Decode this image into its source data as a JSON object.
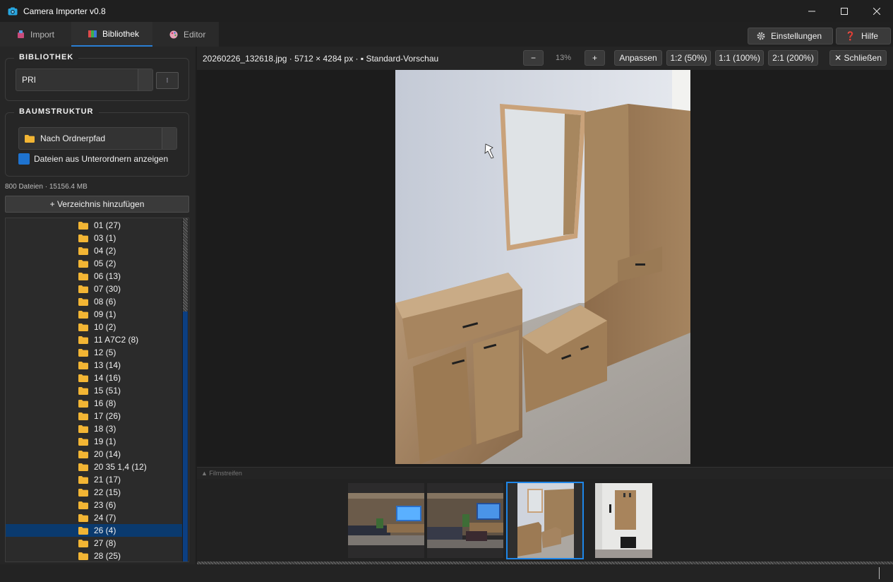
{
  "window": {
    "title": "Camera Importer v0.8"
  },
  "tabs": [
    {
      "label": "Import",
      "icon": "import-icon"
    },
    {
      "label": "Bibliothek",
      "icon": "library-icon"
    },
    {
      "label": "Editor",
      "icon": "palette-icon"
    }
  ],
  "toolbar": {
    "settings_label": "Einstellungen",
    "help_label": "Hilfe",
    "help_glyph": "❓"
  },
  "library": {
    "section_label": "BIBLIOTHEK",
    "selected": "PRI",
    "menu_glyph": "⁝"
  },
  "tree_structure": {
    "section_label": "BAUMSTRUKTUR",
    "selected": "Nach Ordnerpfad",
    "show_subfolders_label": "Dateien aus Unterordnern anzeigen",
    "show_subfolders_checked": true
  },
  "file_info": "800 Dateien  ·  15156.4 MB",
  "add_directory_label": "+ Verzeichnis hinzufügen",
  "folders": [
    "01  (27)",
    "03  (1)",
    "04  (2)",
    "05  (2)",
    "06  (13)",
    "07  (30)",
    "08  (6)",
    "09  (1)",
    "10  (2)",
    "11 A7C2  (8)",
    "12  (5)",
    "13  (14)",
    "14  (16)",
    "15  (51)",
    "16  (8)",
    "17  (26)",
    "18  (3)",
    "19  (1)",
    "20  (14)",
    "20 35 1,4  (12)",
    "21  (17)",
    "22  (15)",
    "23  (6)",
    "24  (7)",
    "26  (4)",
    "27  (8)",
    "28  (25)"
  ],
  "selected_folder": "26  (4)",
  "viewer": {
    "info": "20260226_132618.jpg  ·  5712 × 4284 px  ·  ▪ Standard-Vorschau",
    "zoom_out": "−",
    "zoom_level": "13%",
    "zoom_in": "+",
    "fit": "Anpassen",
    "z50": "1:2 (50%)",
    "z100": "1:1 (100%)",
    "z200": "2:1 (200%)",
    "close": "✕ Schließen"
  },
  "filmstrip": {
    "label": "▲  Filmstreifen",
    "selected_index": 2
  },
  "colors": {
    "accent": "#1e86e8",
    "folder": "#f2b534",
    "selection": "#0a3a6e"
  }
}
